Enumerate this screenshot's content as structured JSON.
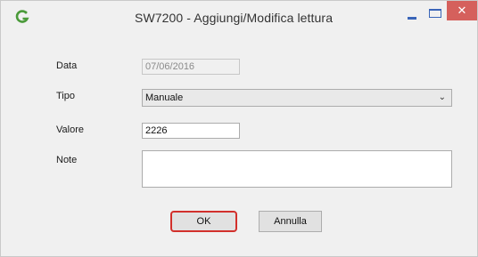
{
  "window": {
    "title": "SW7200 - Aggiungi/Modifica lettura",
    "close_glyph": "✕"
  },
  "form": {
    "data_label": "Data",
    "data_value": "07/06/2016",
    "tipo_label": "Tipo",
    "tipo_value": "Manuale",
    "valore_label": "Valore",
    "valore_value": "2226",
    "note_label": "Note",
    "note_value": ""
  },
  "buttons": {
    "ok_label": "OK",
    "cancel_label": "Annulla"
  },
  "icons": {
    "app": "app-logo-icon",
    "dropdown": "chevron-down-icon"
  },
  "colors": {
    "accent": "#3a65b8",
    "close_bg": "#d5605c",
    "highlight": "#d2302c",
    "app_icon": "#4a9a3a"
  }
}
